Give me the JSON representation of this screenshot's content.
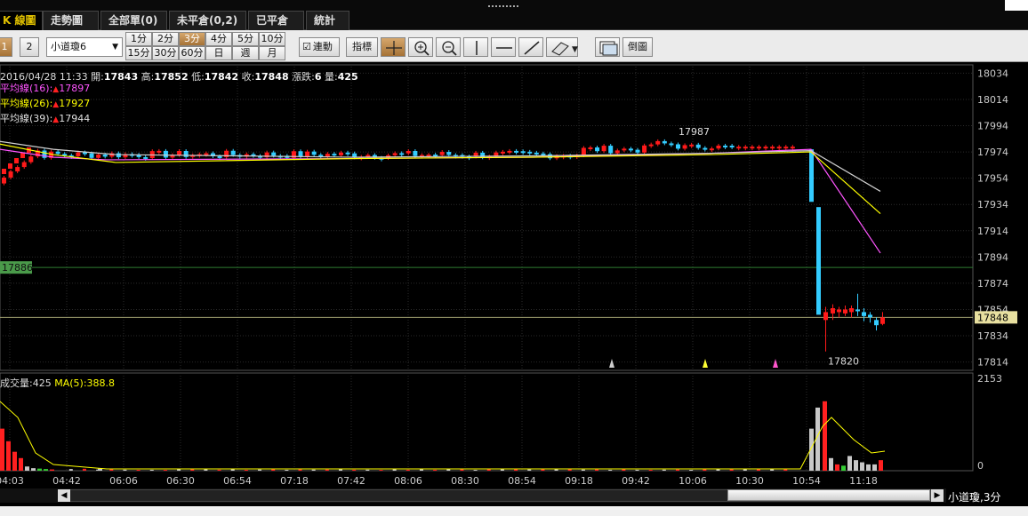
{
  "tabs": [
    {
      "label": "K 線圖",
      "active": true
    },
    {
      "label": "走勢圖",
      "active": false
    },
    {
      "label": "全部單(0)",
      "active": false
    },
    {
      "label": "未平倉(0,2)",
      "active": false
    },
    {
      "label": "已平倉",
      "active": false
    },
    {
      "label": "統計",
      "active": false
    }
  ],
  "toolbar": {
    "page1": "1",
    "page2": "2",
    "symbol_select": "小道瓊6",
    "periods_row1": [
      "1分",
      "2分",
      "3分",
      "4分",
      "5分",
      "10分"
    ],
    "periods_row2": [
      "15分",
      "30分",
      "60分",
      "日",
      "週",
      "月"
    ],
    "active_period": "3分",
    "link_label": "連動",
    "link_checked": true,
    "indicator_label": "指標",
    "invert_label": "倒圖"
  },
  "info": {
    "datetime": "2016/04/28 11:33",
    "open_label": "開:",
    "open": "17843",
    "high_label": "高:",
    "high": "17852",
    "low_label": "低:",
    "low": "17842",
    "close_label": "收:",
    "close": "17848",
    "change_label": "漲跌:",
    "change": "6",
    "volume_label": "量:",
    "volume": "425"
  },
  "moving_averages": [
    {
      "label": "平均線(16):",
      "value": "17897",
      "color": "#ff55ff"
    },
    {
      "label": "平均線(26):",
      "value": "17927",
      "color": "#ffff00"
    },
    {
      "label": "平均線(39):",
      "value": "17944",
      "color": "#e0e0e0"
    }
  ],
  "volinfo": {
    "label": "成交量:",
    "value": "425",
    "ma_label": "MA(5):",
    "ma_value": "388.8"
  },
  "markers": {
    "high_label": "17987",
    "low_label": "17820",
    "price_line_label": "17886",
    "current_price": "17848"
  },
  "chart_data": {
    "type": "candlestick",
    "y_axis_ticks": [
      "18034",
      "18014",
      "17994",
      "17974",
      "17954",
      "17934",
      "17914",
      "17894",
      "17874",
      "17854",
      "17834",
      "17814"
    ],
    "ylim": [
      17809,
      18039
    ],
    "x_axis_ticks": [
      "04:03",
      "04:42",
      "06:06",
      "06:30",
      "06:54",
      "07:18",
      "07:42",
      "08:06",
      "08:30",
      "08:54",
      "09:18",
      "09:42",
      "10:06",
      "10:30",
      "10:54",
      "11:18"
    ],
    "volume_axis_ticks": [
      "2153",
      "0"
    ],
    "volume_ylim": [
      0,
      2153
    ],
    "horizontal_lines": [
      17886,
      17848
    ],
    "series_sample": [
      {
        "name": "price",
        "o": [
          17958,
          17964,
          17970,
          17972,
          17974,
          17972,
          17970,
          17966,
          17974,
          17976,
          17976,
          17972,
          17974,
          17978,
          17980,
          17976,
          17974,
          17972,
          17970,
          17970,
          17972,
          17974,
          17976,
          17980,
          17984,
          17982,
          17978,
          17978,
          17976,
          17978,
          17978,
          17860,
          17852,
          17850,
          17846
        ],
        "c": [
          17964,
          17970,
          17972,
          17974,
          17972,
          17970,
          17966,
          17974,
          17976,
          17976,
          17972,
          17974,
          17978,
          17980,
          17976,
          17974,
          17972,
          17970,
          17970,
          17972,
          17974,
          17976,
          17980,
          17984,
          17982,
          17978,
          17978,
          17976,
          17978,
          17978,
          17860,
          17852,
          17850,
          17846,
          17848
        ]
      }
    ]
  },
  "colors": {
    "up": "#ff1a1a",
    "down": "#33ccff",
    "grid": "#333333",
    "price_line_green": "#2e7d32",
    "current_line": "#9e9e6e"
  },
  "symbol_label": "小道瓊,3分"
}
